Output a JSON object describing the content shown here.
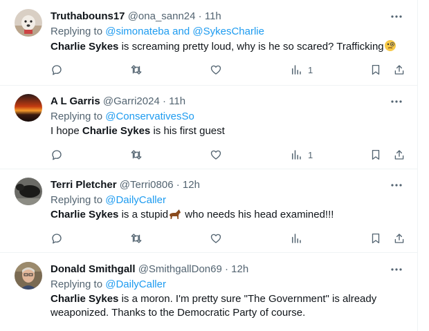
{
  "tweets": [
    {
      "name": "Truthabouns17",
      "handle": "@ona_sann24",
      "time": "11h",
      "replying_prefix": "Replying to ",
      "replying_to": [
        "@simonateba",
        "@SykesCharlie"
      ],
      "replying_joiner": " and ",
      "body_bold": "Charlie Sykes",
      "body_rest": " is screaming pretty loud, why is he so scared? Trafficking",
      "views": "1",
      "emoji": "face-with-monocle"
    },
    {
      "name": "A L Garris",
      "handle": "@Garri2024",
      "time": "11h",
      "replying_prefix": "Replying to ",
      "replying_to": [
        "@ConservativesSo"
      ],
      "body_pre": "I hope ",
      "body_bold": "Charlie Sykes",
      "body_rest": " is his first guest",
      "views": "1"
    },
    {
      "name": "Terri Pletcher",
      "handle": "@Terri0806",
      "time": "12h",
      "replying_prefix": "Replying to ",
      "replying_to": [
        "@DailyCaller"
      ],
      "body_bold": "Charlie Sykes",
      "body_rest": " is a stupid",
      "body_after": " who needs his head examined!!!",
      "views": "",
      "emoji": "horse"
    },
    {
      "name": "Donald Smithgall",
      "handle": "@SmithgallDon69",
      "time": "12h",
      "replying_prefix": "Replying to ",
      "replying_to": [
        "@DailyCaller"
      ],
      "body_bold": "Charlie Sykes",
      "body_rest": " is a moron.  I'm pretty sure \"The Government\" is already weaponized.  Thanks to the Democratic Party of course."
    }
  ],
  "separator": " · ",
  "colors": {
    "text": "#0f1419",
    "secondary": "#536471",
    "link": "#1d9bf0",
    "divider": "#eff3f4"
  },
  "icons": [
    "more-icon",
    "reply-icon",
    "retweet-icon",
    "like-icon",
    "views-icon",
    "bookmark-icon",
    "share-icon"
  ]
}
